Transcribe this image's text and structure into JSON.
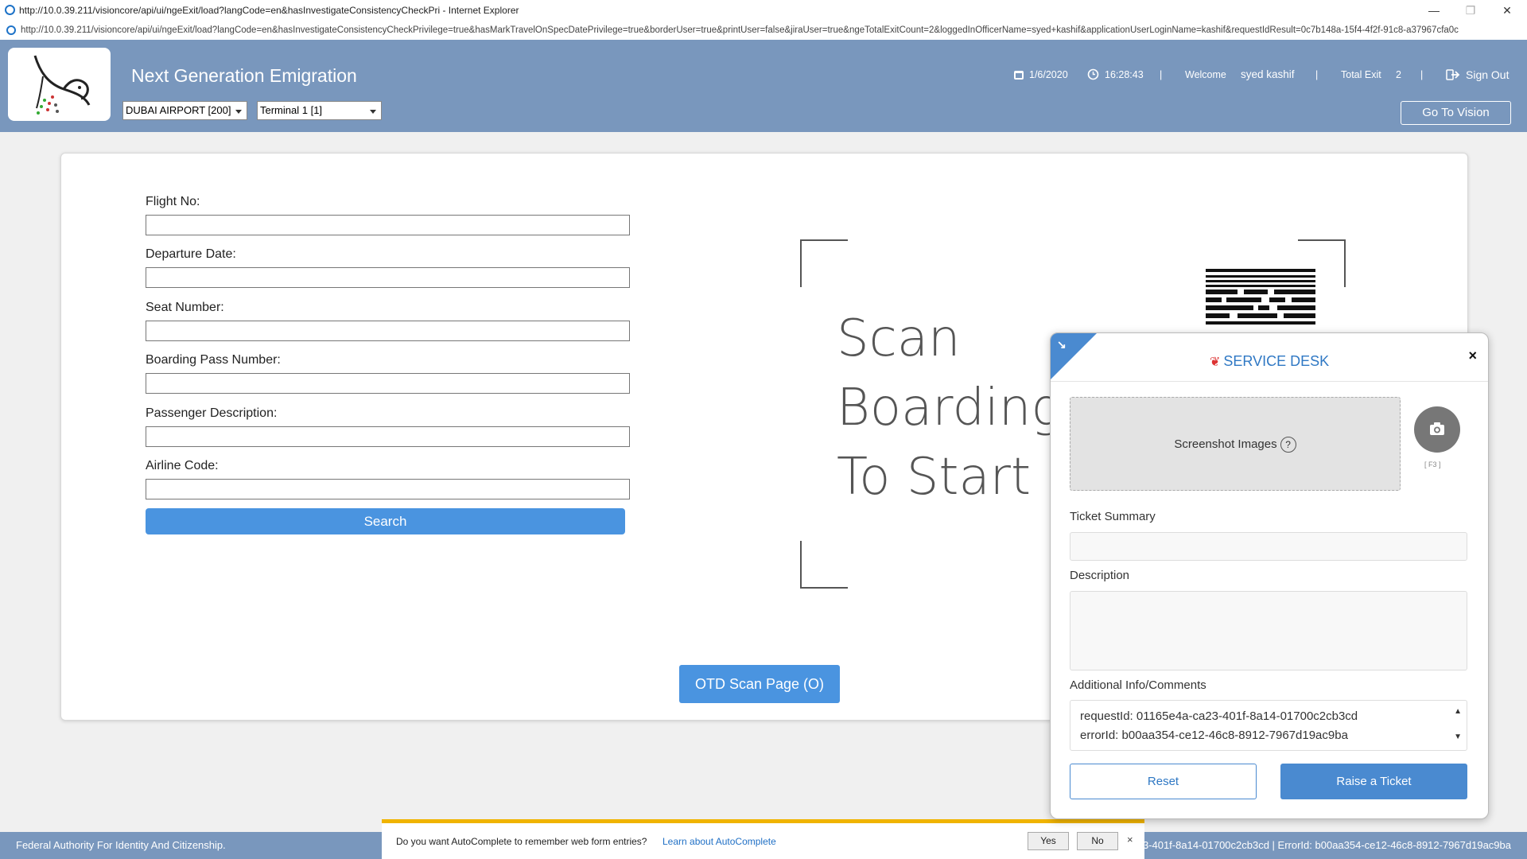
{
  "window": {
    "title": "http://10.0.39.211/visioncore/api/ui/ngeExit/load?langCode=en&hasInvestigateConsistencyCheckPri - Internet Explorer",
    "url": "http://10.0.39.211/visioncore/api/ui/ngeExit/load?langCode=en&hasInvestigateConsistencyCheckPrivilege=true&hasMarkTravelOnSpecDatePrivilege=true&borderUser=true&printUser=false&jiraUser=true&ngeTotalExitCount=2&loggedInOfficerName=syed+kashif&applicationUserLoginName=kashif&requestIdResult=0c7b148a-15f4-4f2f-91c8-a37967cfa0c"
  },
  "header": {
    "app_title": "Next Generation Emigration",
    "airport_select": "DUBAI AIRPORT [200]",
    "terminal_select": "Terminal 1 [1]",
    "date": "1/6/2020",
    "time": "16:28:43",
    "separator": "|",
    "welcome_label": "Welcome",
    "user_name": "syed kashif",
    "total_exit_label": "Total Exit",
    "total_exit_count": "2",
    "sign_out": "Sign Out",
    "go_to_vision": "Go To Vision"
  },
  "form": {
    "flight_no_label": "Flight No:",
    "departure_date_label": "Departure Date:",
    "seat_number_label": "Seat Number:",
    "boarding_pass_label": "Boarding Pass Number:",
    "passenger_desc_label": "Passenger Description:",
    "airline_code_label": "Airline Code:",
    "search_button": "Search"
  },
  "scan": {
    "line1": "Scan",
    "line2": "Boarding Pass",
    "line3": "To Start"
  },
  "otd_button": "OTD Scan Page (O)",
  "footer": {
    "left": "Federal Authority For Identity And Citizenship.",
    "right": "3-401f-8a14-01700c2cb3cd | ErrorId: b00aa354-ce12-46c8-8912-7967d19ac9ba"
  },
  "autocomplete": {
    "message": "Do you want AutoComplete to remember web form entries?",
    "learn_link": "Learn about AutoComplete",
    "yes": "Yes",
    "no": "No",
    "close": "×"
  },
  "service_desk": {
    "title": "SERVICE DESK",
    "screenshot_label": "Screenshot Images",
    "help": "?",
    "camera_hint": "[ F3 ]",
    "ticket_summary_label": "Ticket Summary",
    "description_label": "Description",
    "additional_label": "Additional Info/Comments",
    "comment_line1": "requestId: 01165e4a-ca23-401f-8a14-01700c2cb3cd",
    "comment_line2": "errorId: b00aa354-ce12-46c8-8912-7967d19ac9ba",
    "reset": "Reset",
    "raise": "Raise a Ticket",
    "close": "×"
  },
  "colors": {
    "header_bg": "#7997bd",
    "primary_button": "#4a94e0",
    "service_desk_accent": "#2f78c4"
  }
}
